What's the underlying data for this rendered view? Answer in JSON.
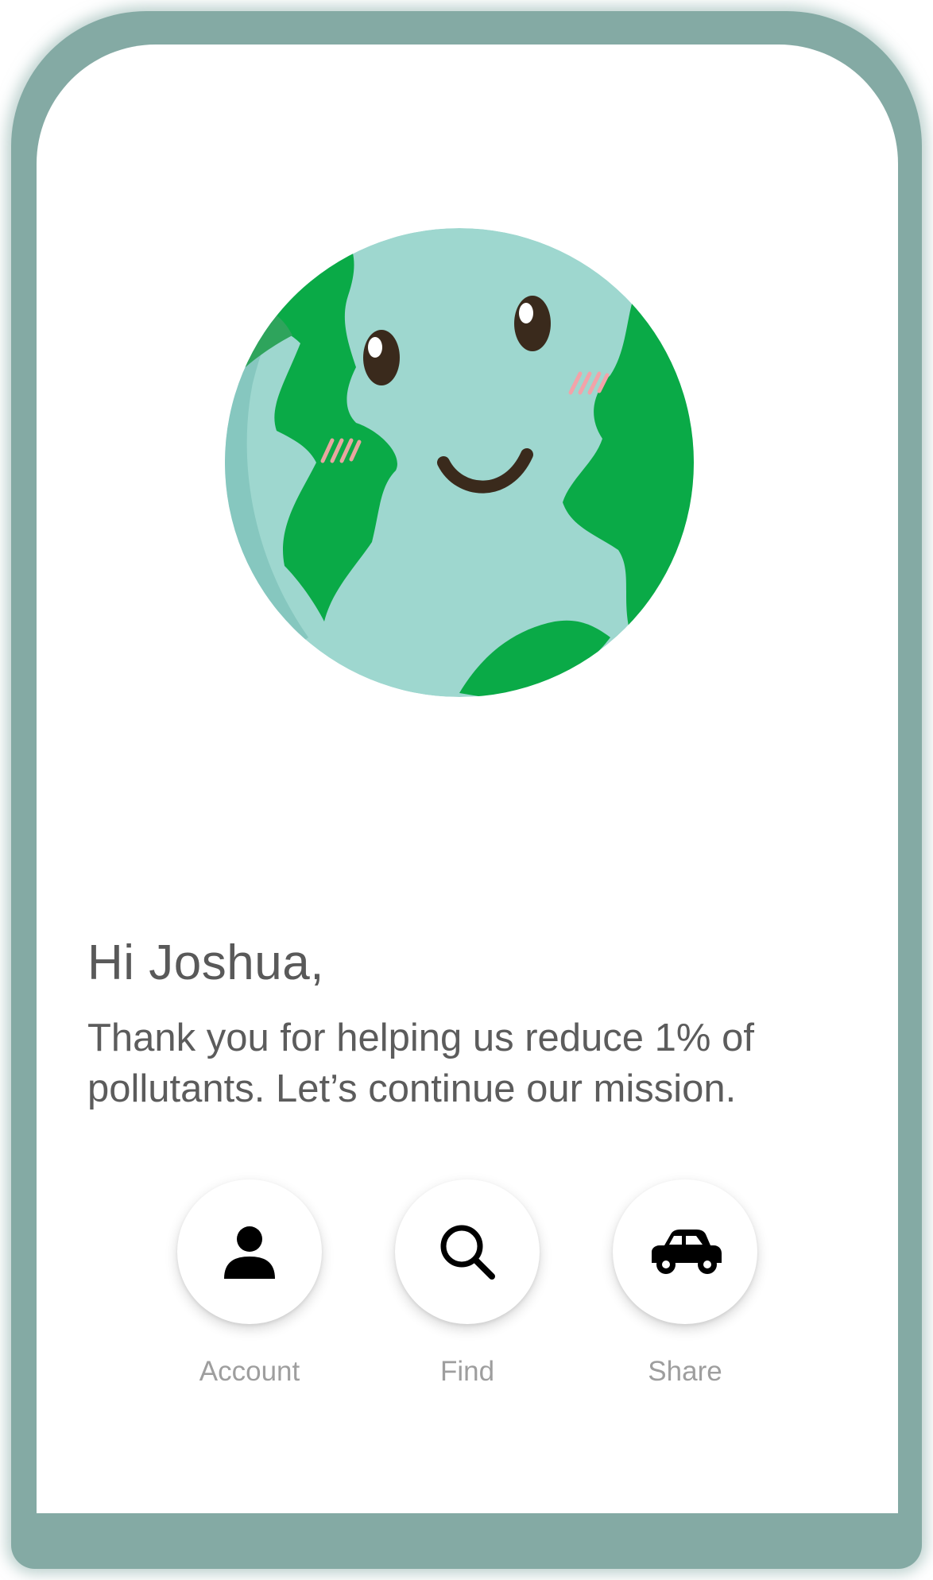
{
  "greeting": "Hi Joshua,",
  "message": "Thank you for helping us reduce 1% of pollutants. Let’s continue our mission.",
  "actions": [
    {
      "label": "Account",
      "icon": "person-icon"
    },
    {
      "label": "Find",
      "icon": "search-icon"
    },
    {
      "label": "Share",
      "icon": "car-icon"
    }
  ],
  "colors": {
    "frame": "#84aaa4",
    "ocean": "#9ed7cf",
    "land": "#0aaa47",
    "text": "#595959",
    "label": "#9e9e9e"
  }
}
